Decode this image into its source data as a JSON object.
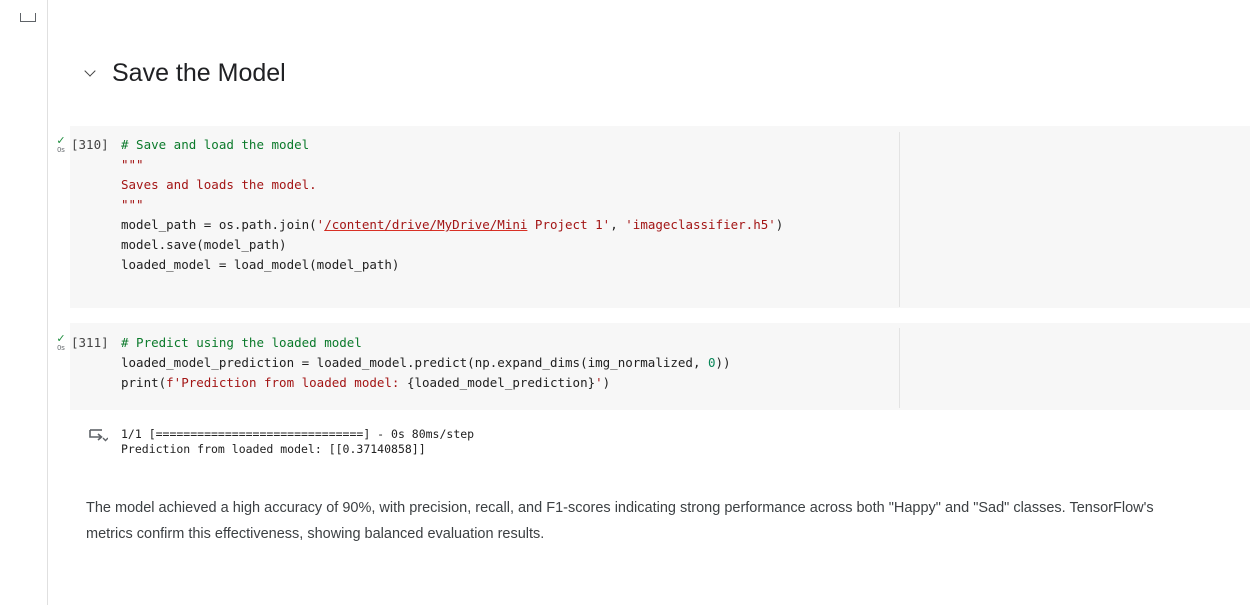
{
  "section": {
    "title": "Save the Model"
  },
  "cells": [
    {
      "exec_count": "[310]",
      "run_time": "0s",
      "lines": [
        [
          {
            "t": "# Save and load the model",
            "c": "c-com"
          }
        ],
        [
          {
            "t": "\"\"\"",
            "c": "c-str"
          }
        ],
        [
          {
            "t": "Saves and loads the model.",
            "c": "c-str"
          }
        ],
        [
          {
            "t": "\"\"\"",
            "c": "c-str"
          }
        ],
        [
          {
            "t": "model_path = os.path.join("
          },
          {
            "t": "'",
            "c": "c-str"
          },
          {
            "t": "/content/drive/MyDrive/Mini",
            "c": "c-str c-link"
          },
          {
            "t": " Project 1'",
            "c": "c-str"
          },
          {
            "t": ", "
          },
          {
            "t": "'imageclassifier.h5'",
            "c": "c-str"
          },
          {
            "t": ")"
          }
        ],
        [
          {
            "t": "model.save(model_path)"
          }
        ],
        [
          {
            "t": "loaded_model = load_model(model_path)"
          }
        ]
      ]
    },
    {
      "exec_count": "[311]",
      "run_time": "0s",
      "lines": [
        [
          {
            "t": "# Predict using the loaded model",
            "c": "c-com"
          }
        ],
        [
          {
            "t": "loaded_model_prediction = loaded_model.predict(np.expand_dims(img_normalized, "
          },
          {
            "t": "0",
            "c": "c-num"
          },
          {
            "t": "))"
          }
        ],
        [
          {
            "t": "print("
          },
          {
            "t": "f'Prediction from loaded model: ",
            "c": "c-str"
          },
          {
            "t": "{loaded_model_prediction}"
          },
          {
            "t": "'",
            "c": "c-str"
          },
          {
            "t": ")"
          }
        ]
      ]
    }
  ],
  "output": {
    "progress": "1/1 [==============================] - 0s 80ms/step",
    "prediction": "Prediction from loaded model: [[0.37140858]]"
  },
  "markdown": "The model achieved a high accuracy of 90%, with precision, recall, and F1-scores indicating strong performance across both \"Happy\" and \"Sad\" classes. TensorFlow's metrics confirm this effectiveness, showing balanced evaluation results."
}
